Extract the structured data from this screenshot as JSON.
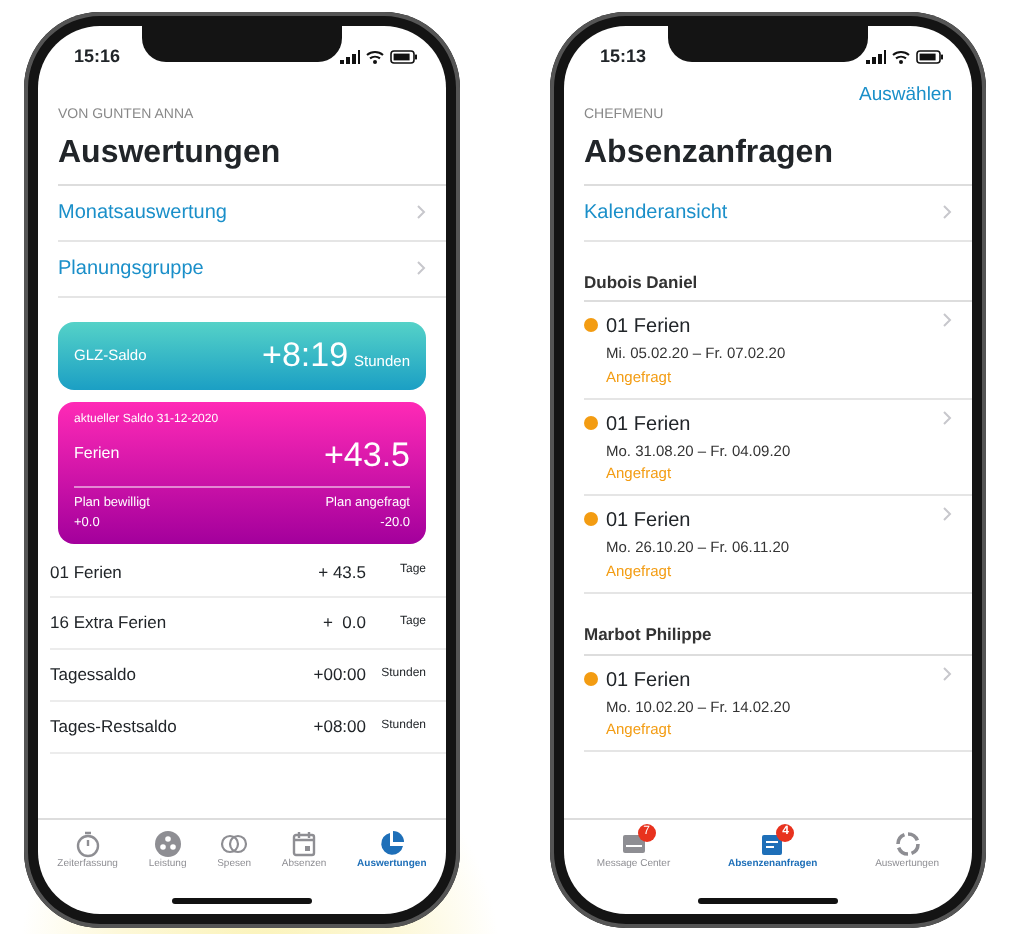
{
  "phones": [
    {
      "kind": "report",
      "status_time": "15:16",
      "caption": "VON GUNTEN ANNA",
      "title": "Auswertungen",
      "links": [
        "Monatsauswertung",
        "Planungsgruppe"
      ],
      "glz_card": {
        "label": "GLZ-Saldo",
        "value": "+8:19",
        "unit": "Stunden"
      },
      "vacation_card": {
        "caption": "aktueller Saldo 31-12-2020",
        "label": "Ferien",
        "value": "+43.5",
        "approved_label": "Plan bewilligt",
        "approved_value": "+0.0",
        "requested_label": "Plan angefragt",
        "requested_value": "-20.0"
      },
      "rows": [
        {
          "label": "01 Ferien",
          "value": "+ 43.5",
          "unit": "Tage"
        },
        {
          "label": "16 Extra Ferien",
          "value": "+  0.0",
          "unit": "Tage"
        },
        {
          "label": "Tagessaldo",
          "value": "+00:00",
          "unit": "Stunden"
        },
        {
          "label": "Tages-Restsaldo",
          "value": "+08:00",
          "unit": "Stunden"
        }
      ],
      "tabs": [
        {
          "label": "Zeiterfassung",
          "selected": false
        },
        {
          "label": "Leistung",
          "selected": false
        },
        {
          "label": "Spesen",
          "selected": false
        },
        {
          "label": "Absenzen",
          "selected": false
        },
        {
          "label": "Auswertungen",
          "selected": true
        }
      ]
    },
    {
      "kind": "requests",
      "status_time": "15:13",
      "nav_action": "Auswählen",
      "caption": "CHEFMENU",
      "title": "Absenzanfragen",
      "links": [
        "Kalenderansicht"
      ],
      "groups": [
        {
          "name": "Dubois Daniel",
          "requests": [
            {
              "title": "01 Ferien",
              "dates": "Mi. 05.02.20 – Fr. 07.02.20",
              "status": "Angefragt",
              "color": "#f39c12"
            },
            {
              "title": "01 Ferien",
              "dates": "Mo. 31.08.20 – Fr. 04.09.20",
              "status": "Angefragt",
              "color": "#f39c12"
            },
            {
              "title": "01 Ferien",
              "dates": "Mo. 26.10.20 – Fr. 06.11.20",
              "status": "Angefragt",
              "color": "#f39c12"
            }
          ]
        },
        {
          "name": "Marbot Philippe",
          "requests": [
            {
              "title": "01 Ferien",
              "dates": "Mo. 10.02.20 – Fr. 14.02.20",
              "status": "Angefragt",
              "color": "#f39c12"
            }
          ]
        }
      ],
      "tabs": [
        {
          "label": "Message Center",
          "selected": false,
          "badge": "7"
        },
        {
          "label": "Absenzenanfragen",
          "selected": true,
          "badge": "4"
        },
        {
          "label": "Auswertungen",
          "selected": false
        }
      ]
    }
  ]
}
